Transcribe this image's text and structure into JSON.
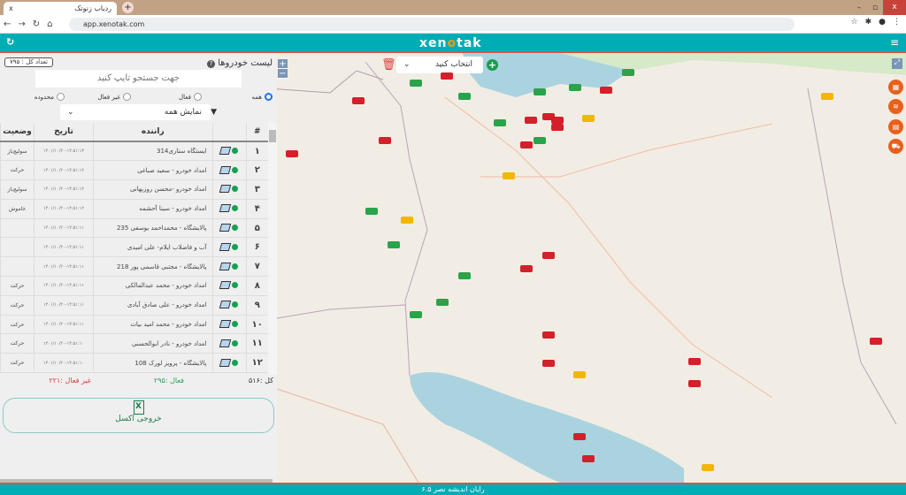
{
  "browser": {
    "tab_title": "ردیاب زنوتک",
    "tab_close": "x",
    "new_tab": "+",
    "url": "app.xenotak.com"
  },
  "app": {
    "logo_left": "xen",
    "logo_mid": "o",
    "logo_right": "tak",
    "footer": "رایان اندیشه نصر ۶.۵"
  },
  "panel": {
    "title": "لیست خودروها",
    "total_badge": "تعداد کل : ۷۹۵",
    "search_placeholder": "جهت جستجو تایپ کنید",
    "radios": [
      {
        "label": "همه",
        "checked": true
      },
      {
        "label": "فعال",
        "checked": false
      },
      {
        "label": "غیر فعال",
        "checked": false
      },
      {
        "label": "محدوده",
        "checked": false
      }
    ],
    "filter_value": "نمایش همه",
    "columns": [
      "#",
      "",
      "راننده",
      "تاریخ",
      "وضعیت"
    ],
    "rows": [
      {
        "num": "۱",
        "driver": "ایستگاه ستاری314",
        "date": "۱۴۰۱/۱۰/۲۰-۱۴:۵۱:۱۳",
        "status": "سولیچ‌باز"
      },
      {
        "num": "۲",
        "driver": "امداد خودرو - سعید صباغی",
        "date": "۱۴۰۱/۱۰/۲۰-۱۴:۵۱:۱۲",
        "status": "حرکت"
      },
      {
        "num": "۳",
        "driver": "امداد خودرو -محسن روزبهانی",
        "date": "۱۴۰۱/۱۰/۲۰-۱۴:۵۱:۱۲",
        "status": "سولیچ‌باز"
      },
      {
        "num": "۴",
        "driver": "امداد خودرو - سینا آحشمه",
        "date": "۱۴۰۱/۱۰/۲۰-۱۴:۵۱:۱۲",
        "status": "خاموش"
      },
      {
        "num": "۵",
        "driver": "پالایشگاه - محمداحمد یوسفی 235",
        "date": "۱۴۰۱/۱۰/۲۰-۱۴:۵۱:۱۱",
        "status": ""
      },
      {
        "num": "۶",
        "driver": "آب و فاضلاب ایلام- علی امیدی",
        "date": "۱۴۰۱/۱۰/۲۰-۱۴:۵۱:۱۱",
        "status": ""
      },
      {
        "num": "۷",
        "driver": "پالایشگاه - مجتبی قاسمی پور 218",
        "date": "۱۴۰۱/۱۰/۲۰-۱۴:۵۱:۱۱",
        "status": ""
      },
      {
        "num": "۸",
        "driver": "امداد خودرو - محمد عبدالمالکی",
        "date": "۱۴۰۱/۱۰/۲۰-۱۴:۵۱:۱۱",
        "status": "حرکت"
      },
      {
        "num": "۹",
        "driver": "امداد خودرو - علی صادق آبادی",
        "date": "۱۴۰۱/۱۰/۲۰-۱۴:۵۱:۱۱",
        "status": "حرکت"
      },
      {
        "num": "۱۰",
        "driver": "امداد خودرو - محمد امید بیات",
        "date": "۱۴۰۱/۱۰/۲۰-۱۴:۵۱:۱۱",
        "status": "حرکت"
      },
      {
        "num": "۱۱",
        "driver": "امداد خودرو - نادر ابوالحسنی",
        "date": "۱۴۰۱/۱۰/۲۰-۱۴:۵۱:۱۰",
        "status": "حرکت"
      },
      {
        "num": "۱۲",
        "driver": "پالایشگاه - پرویز لورک 108",
        "date": "۱۴۰۱/۱۰/۲۰-۱۴:۵۱:۱۰",
        "status": "حرکت"
      }
    ],
    "count_total": "کل :۵۱۶",
    "count_active": "فعال :۲۹۵",
    "count_inactive": "غیر فعال :۲۲۱",
    "excel_label": "خروجی اکسل"
  },
  "map": {
    "select_placeholder": "انتخاب کنید",
    "zoom_in": "+",
    "zoom_out": "−"
  },
  "colors": {
    "teal": "#00adb5",
    "active": "#2e9e5b",
    "inactive": "#e0393e",
    "accent": "#e8601c"
  }
}
